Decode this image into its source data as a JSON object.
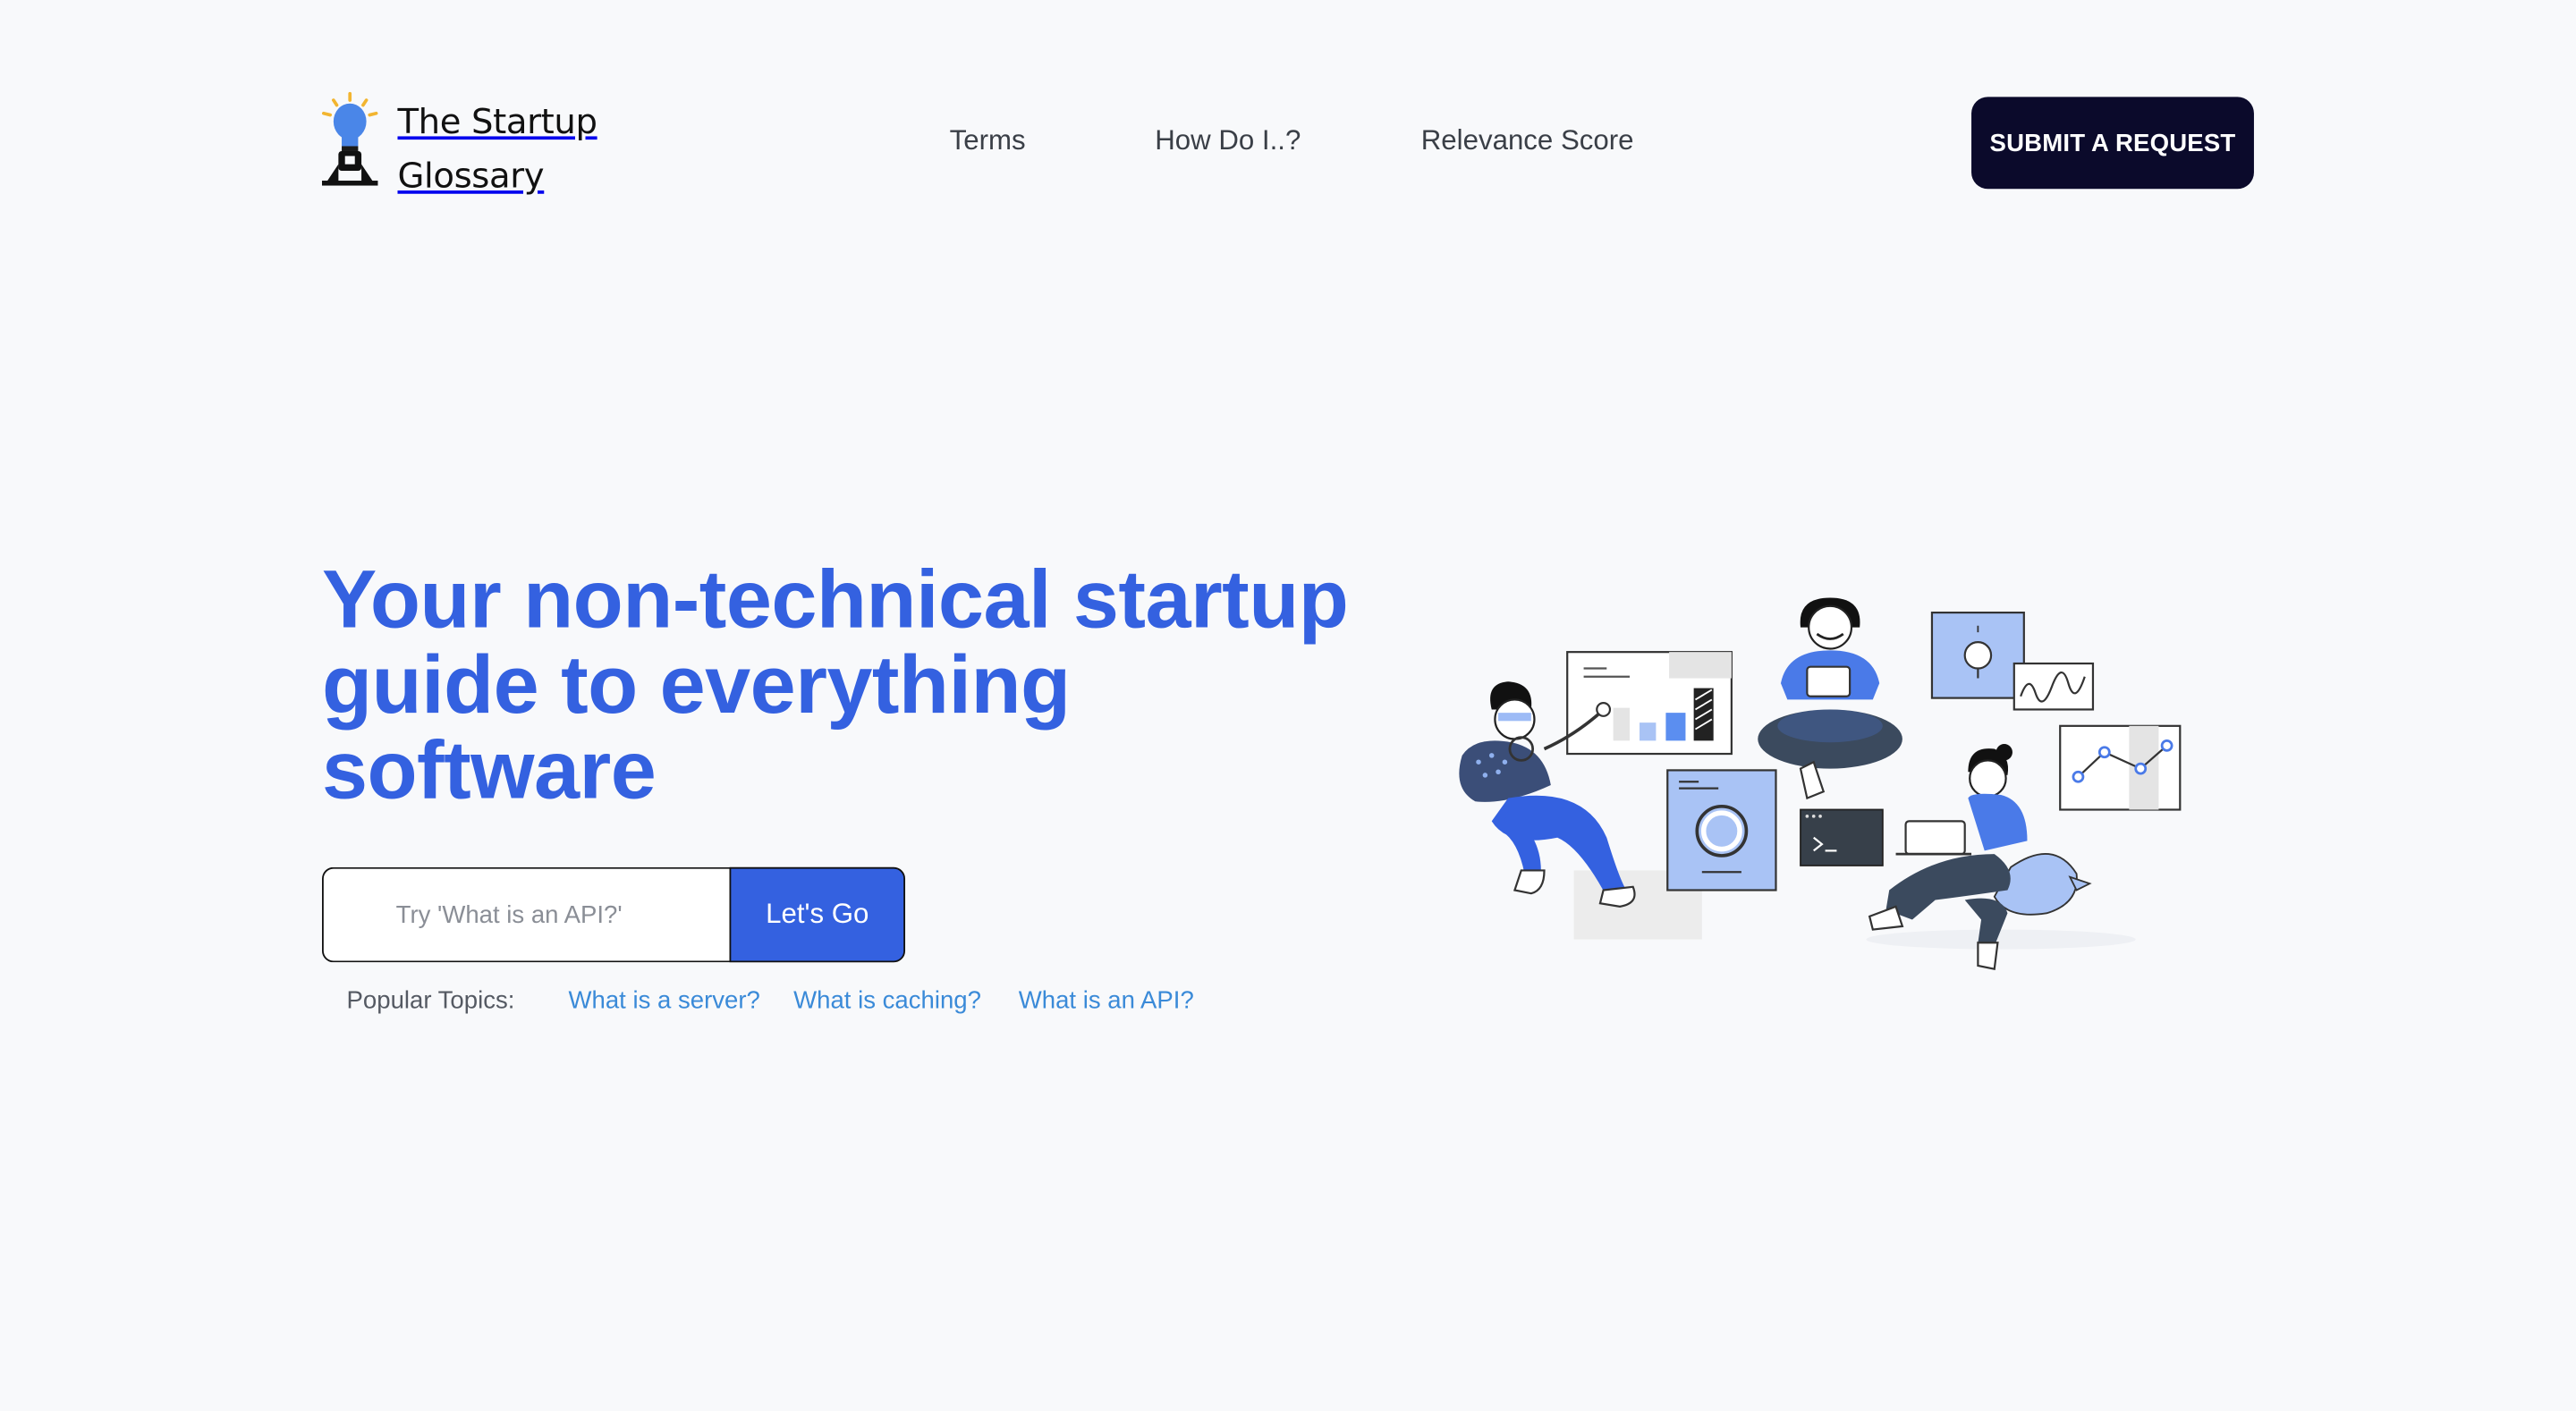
{
  "brand": {
    "name_line1": "The Startup",
    "name_line2": "Glossary",
    "icon": "lightbulb-rocket-icon",
    "accent": "#3461e0"
  },
  "nav": {
    "items": [
      {
        "label": "Terms"
      },
      {
        "label": "How Do I..?"
      },
      {
        "label": "Relevance Score"
      }
    ],
    "cta_label": "SUBMIT A REQUEST"
  },
  "hero": {
    "title": "Your non-technical startup guide to everything software",
    "search": {
      "placeholder": "Try 'What is an API?'",
      "button_label": "Let's Go"
    },
    "popular": {
      "label": "Popular Topics:",
      "topics": [
        {
          "label": "What is a server?"
        },
        {
          "label": "What is caching?"
        },
        {
          "label": "What is an API?"
        }
      ]
    }
  },
  "colors": {
    "background": "#f8f9fb",
    "primary": "#3461e0",
    "dark_button": "#0b0a2b",
    "link": "#3a8ad8"
  }
}
